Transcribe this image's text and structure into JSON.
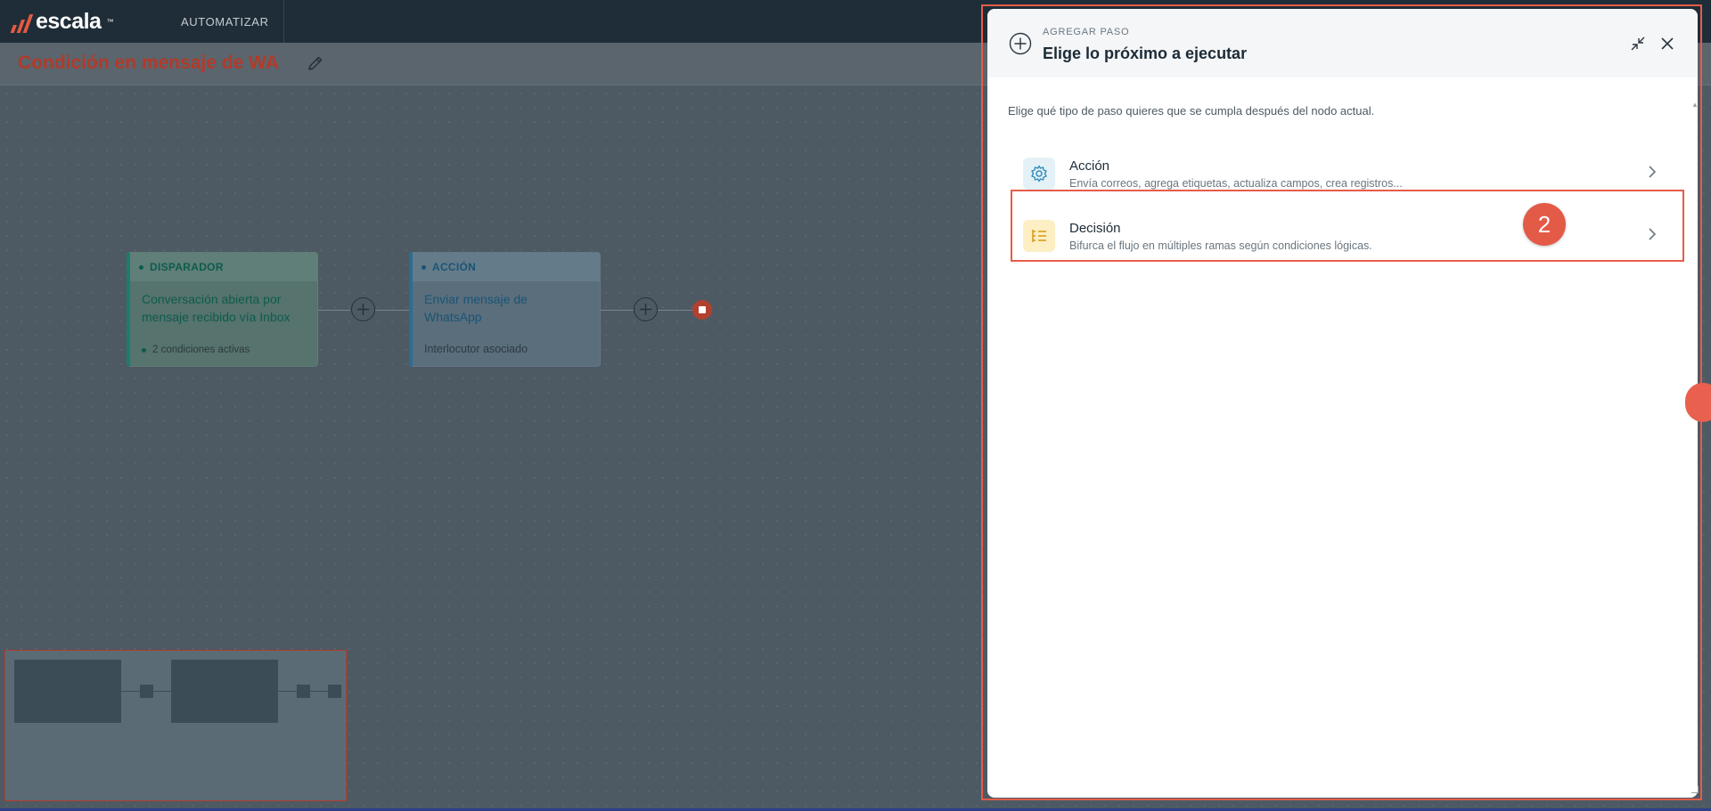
{
  "app": {
    "brand": "escala",
    "brand_mark": "™",
    "nav_item": "AUTOMATIZAR"
  },
  "page": {
    "title": "Condición en mensaje de WA"
  },
  "flow": {
    "trigger": {
      "tag": "DISPARADOR",
      "title": "Conversación abierta por mensaje recibido vía Inbox",
      "sub": "2 condiciones activas"
    },
    "action": {
      "tag": "ACCIÓN",
      "title": "Enviar mensaje de WhatsApp",
      "sub": "Interlocutor asociado"
    }
  },
  "panel": {
    "eyebrow": "AGREGAR PASO",
    "title": "Elige lo próximo a ejecutar",
    "description": "Elige qué tipo de paso quieres que se cumpla después del nodo actual.",
    "options": [
      {
        "label": "Acción",
        "description": "Envía correos, agrega etiquetas, actualiza campos, crea registros...",
        "icon": "gear-icon"
      },
      {
        "label": "Decisión",
        "description": "Bifurca el flujo en múltiples ramas según condiciones lógicas.",
        "icon": "branch-list-icon"
      }
    ]
  },
  "annotation": {
    "step_number": "2"
  },
  "colors": {
    "brand_accent": "#e45a40",
    "annotation_red": "#e65c4a",
    "trigger_green": "#1a7d6e",
    "action_blue": "#2b6d94"
  }
}
